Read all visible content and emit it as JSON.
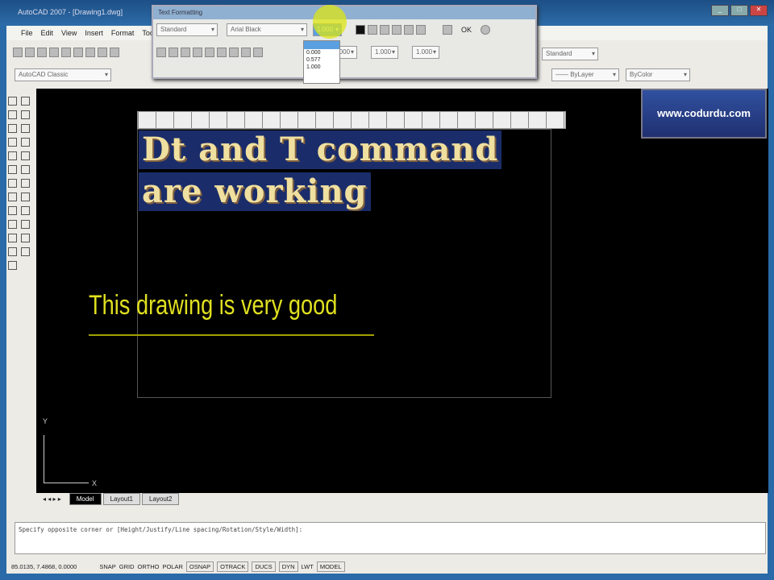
{
  "window": {
    "title": "AutoCAD 2007 - [Drawing1.dwg]",
    "controls": [
      "_",
      "□",
      "✕"
    ]
  },
  "menu": [
    "File",
    "Edit",
    "View",
    "Insert",
    "Format",
    "Tools"
  ],
  "toolbars": {
    "workspace": "AutoCAD Classic",
    "style_combo": "Standard",
    "linetype": "—— ByLayer",
    "color": "ByColor"
  },
  "text_formatting": {
    "title": "Text Formatting",
    "style": "Standard",
    "font": "Arial Black",
    "height": "1.000",
    "height_options": [
      "0.000",
      "0.577",
      "1.000"
    ],
    "ok": "OK",
    "oblique": "0.000",
    "tracking": "1.000",
    "width_factor": "1.000"
  },
  "drawing": {
    "mtext_line1": "Dt and T command",
    "mtext_line2": "are working",
    "dtext": "This drawing is very good",
    "watermark": "www.codurdu.com",
    "ucs_y": "Y",
    "ucs_x": "X"
  },
  "tabs": [
    "Model",
    "Layout1",
    "Layout2"
  ],
  "command": {
    "prompt": "Specify opposite corner or [Height/Justify/Line spacing/Rotation/Style/Width]:"
  },
  "status": {
    "coords": "85.0135, 7.4868, 0.0000",
    "buttons": [
      "SNAP",
      "GRID",
      "ORTHO",
      "POLAR",
      "OSNAP",
      "OTRACK",
      "DUCS",
      "DYN",
      "LWT",
      "MODEL"
    ]
  }
}
